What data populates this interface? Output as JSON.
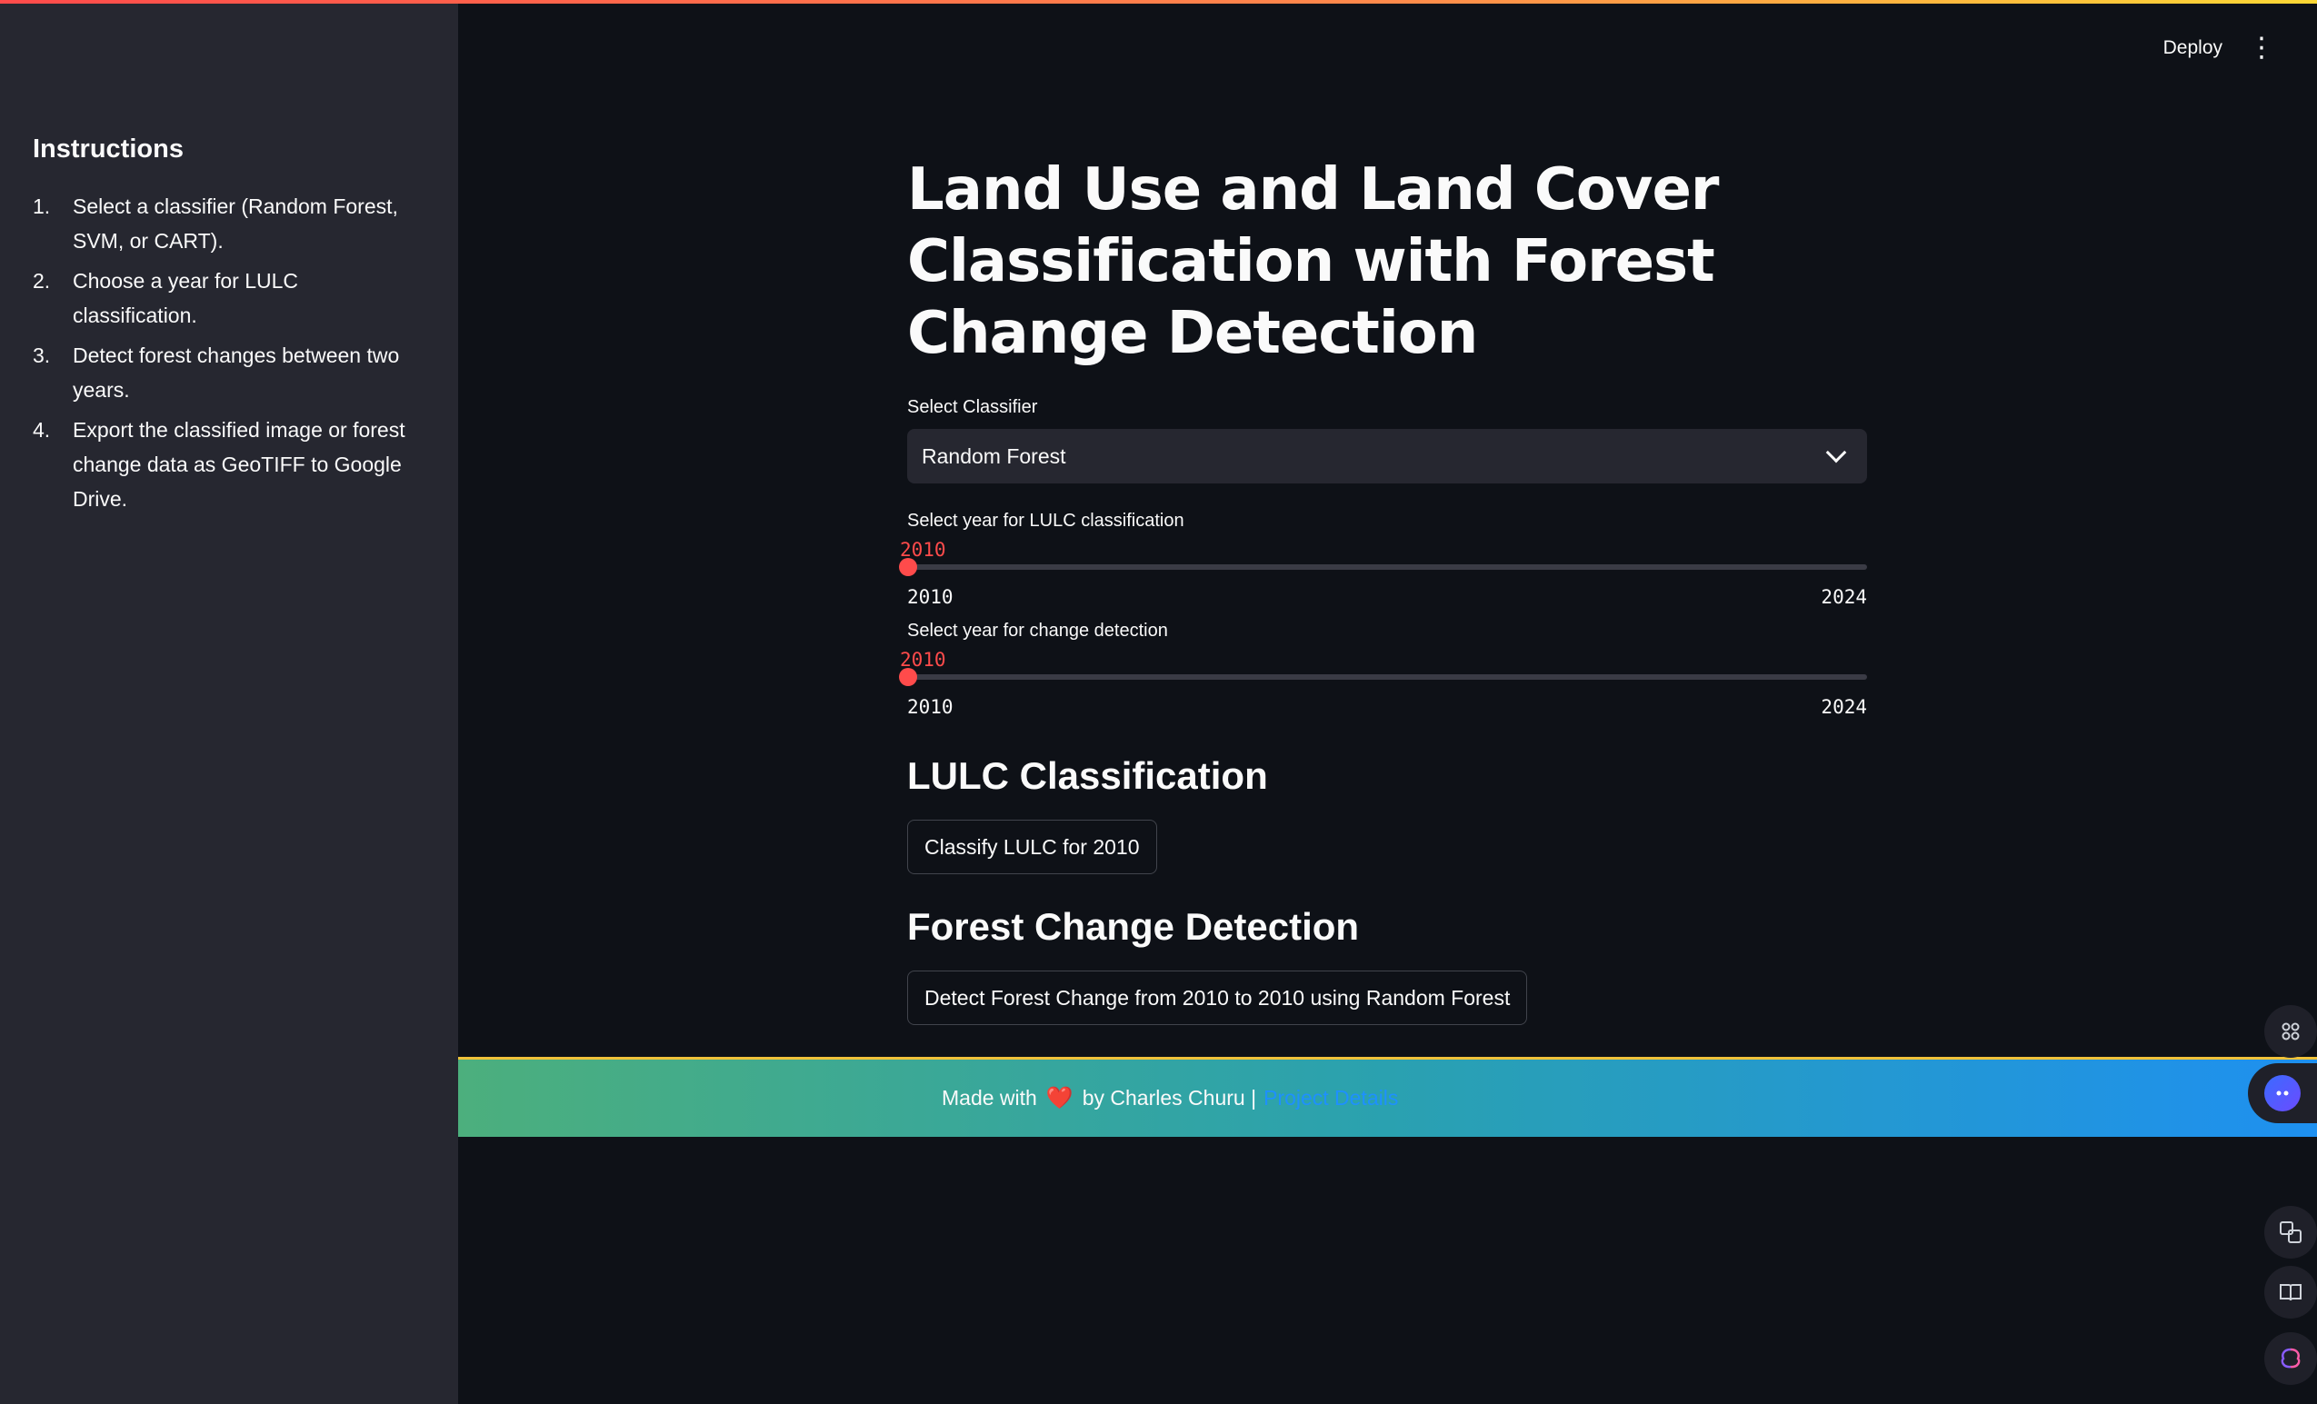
{
  "header": {
    "deploy_label": "Deploy",
    "menu_icon": "⋮"
  },
  "sidebar": {
    "heading": "Instructions",
    "items": [
      {
        "num": "1.",
        "text": "Select a classifier (Random Forest, SVM, or CART)."
      },
      {
        "num": "2.",
        "text": "Choose a year for LULC classification."
      },
      {
        "num": "3.",
        "text": "Detect forest changes between two years."
      },
      {
        "num": "4.",
        "text": "Export the classified image or forest change data as GeoTIFF to Google Drive."
      }
    ]
  },
  "main": {
    "title": "Land Use and Land Cover Classification with Forest Change Detection",
    "classifier": {
      "label": "Select Classifier",
      "selected": "Random Forest"
    },
    "lulc_slider": {
      "label": "Select year for LULC classification",
      "value": "2010",
      "min": "2010",
      "max": "2024",
      "fraction": 0
    },
    "change_slider": {
      "label": "Select year for change detection",
      "value": "2010",
      "min": "2010",
      "max": "2024",
      "fraction": 0
    },
    "lulc_section": {
      "heading": "LULC Classification",
      "button": "Classify LULC for 2010"
    },
    "forest_section": {
      "heading": "Forest Change Detection",
      "button": "Detect Forest Change from 2010 to 2010 using Random Forest"
    }
  },
  "footer": {
    "made_with": "Made with",
    "heart": "❤️",
    "by": "by Charles Churu |",
    "link_text": "Project Details"
  },
  "colors": {
    "background": "#0e1117",
    "sidebar": "#262730",
    "accent": "#ff4b4b"
  }
}
